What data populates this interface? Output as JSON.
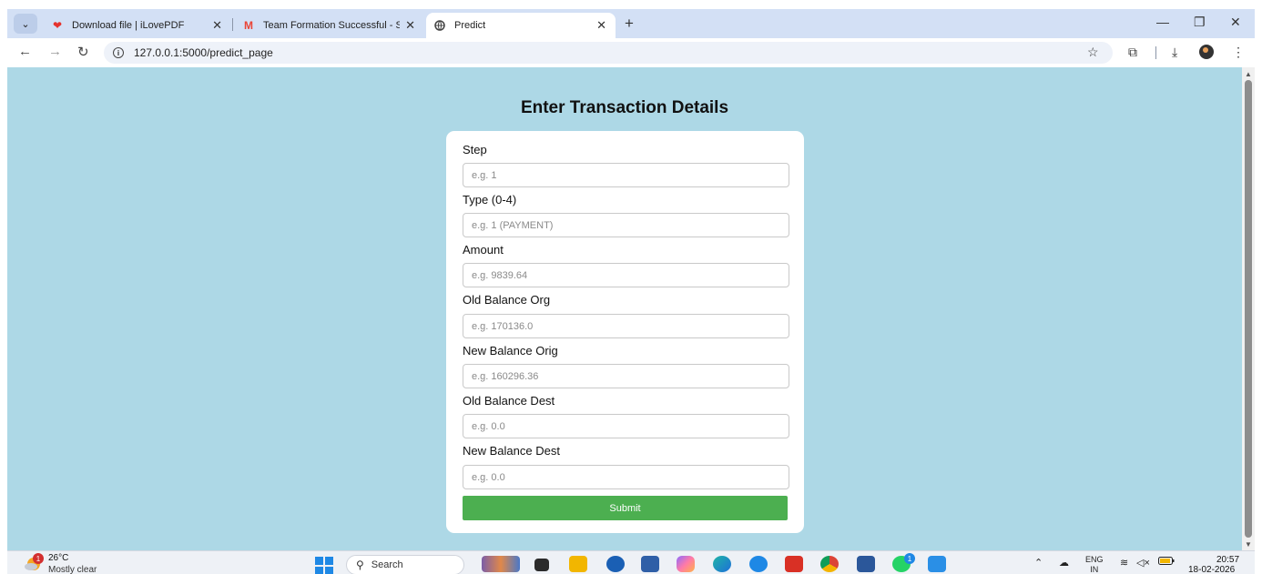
{
  "browser": {
    "tabs": [
      {
        "title": "Download file | iLovePDF",
        "icon": "heart-icon",
        "icon_color": "#e5322d"
      },
      {
        "title": "Team Formation Successful - Sm",
        "icon": "gmail-icon",
        "icon_color": "#ea4335"
      },
      {
        "title": "Predict",
        "icon": "globe-icon",
        "icon_color": "#444444"
      }
    ],
    "active_tab": 2,
    "new_tab_label": "+",
    "url": "127.0.0.1:5000/predict_page"
  },
  "page": {
    "title": "Enter Transaction Details",
    "background_color": "#add8e6",
    "fields": [
      {
        "label": "Step",
        "placeholder": "e.g. 1"
      },
      {
        "label": "Type (0-4)",
        "placeholder": "e.g. 1 (PAYMENT)"
      },
      {
        "label": "Amount",
        "placeholder": "e.g. 9839.64"
      },
      {
        "label": "Old Balance Org",
        "placeholder": "e.g. 170136.0"
      },
      {
        "label": "New Balance Orig",
        "placeholder": "e.g. 160296.36"
      },
      {
        "label": "Old Balance Dest",
        "placeholder": "e.g. 0.0"
      },
      {
        "label": "New Balance Dest",
        "placeholder": "e.g. 0.0"
      }
    ],
    "submit_label": "Submit",
    "submit_color": "#4caf50"
  },
  "taskbar": {
    "weather_temp": "26°C",
    "weather_desc": "Mostly clear",
    "weather_badge": "1",
    "search_label": "Search",
    "lang_top": "ENG",
    "lang_bottom": "IN",
    "time": "20:57",
    "date": "18-02-2026",
    "whatsapp_badge": "1"
  }
}
